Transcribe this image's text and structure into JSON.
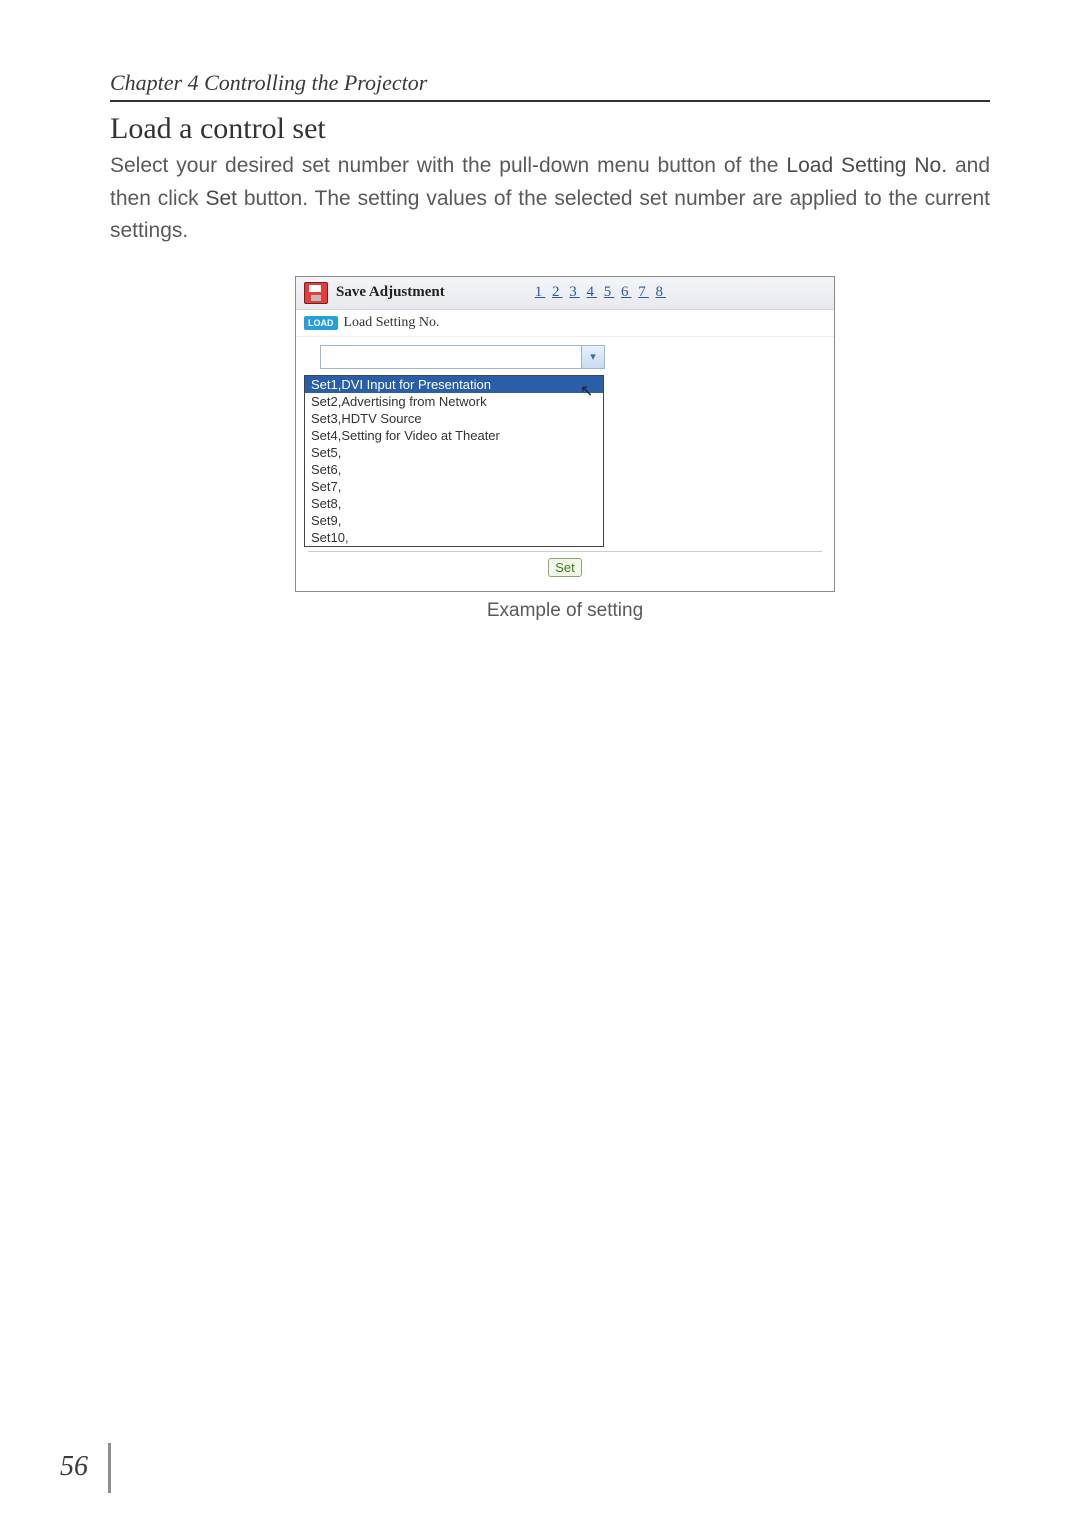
{
  "header": {
    "chapter": "Chapter 4 Controlling the Projector"
  },
  "section": {
    "title": "Load a control set"
  },
  "body": {
    "p1a": "Select your desired set number with the pull-down menu button of the ",
    "p1_kw1": "Load Setting No.",
    "p1b": " and then click ",
    "p1_kw2": "Set",
    "p1c": " button. The setting values of the selected set number are applied to the current settings."
  },
  "panel": {
    "save_label": "Save Adjustment",
    "pages": [
      "1",
      "2",
      "3",
      "4",
      "5",
      "6",
      "7",
      "8"
    ],
    "load_badge": "LOAD",
    "load_label": "Load Setting No.",
    "dropdown_value": "",
    "options": [
      "Set1,DVI Input for Presentation",
      "Set2,Advertising from Network",
      "Set3,HDTV Source",
      "Set4,Setting for Video at Theater",
      "Set5,",
      "Set6,",
      "Set7,",
      "Set8,",
      "Set9,",
      "Set10,"
    ],
    "set_button": "Set"
  },
  "caption": "Example of setting",
  "page_number": "56"
}
